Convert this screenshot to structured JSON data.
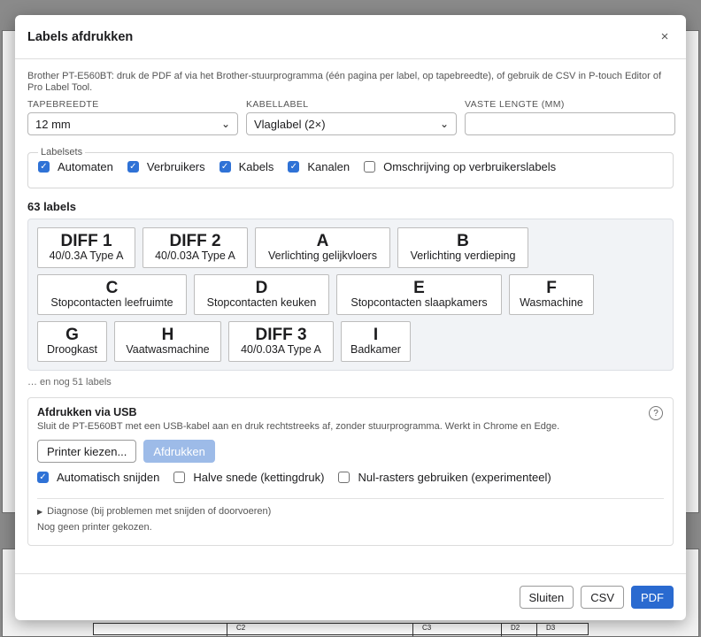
{
  "dialog": {
    "title": "Labels afdrukken",
    "close_glyph": "×",
    "intro": "Brother PT-E560BT: druk de PDF af via het Brother-stuurprogramma (één pagina per label, op tapebreedte), of gebruik de CSV in P-touch Editor of Pro Label Tool."
  },
  "fields": {
    "tape_label": "TAPEBREEDTE",
    "tape_value": "12 mm",
    "cable_label": "KABELLABEL",
    "cable_value": "Vlaglabel (2×)",
    "length_label": "VASTE LENGTE (MM)",
    "length_value": ""
  },
  "labelsets": {
    "legend": "Labelsets",
    "items": [
      {
        "label": "Automaten",
        "checked": true
      },
      {
        "label": "Verbruikers",
        "checked": true
      },
      {
        "label": "Kabels",
        "checked": true
      },
      {
        "label": "Kanalen",
        "checked": true
      },
      {
        "label": "Omschrijving op verbruikerslabels",
        "checked": false
      }
    ]
  },
  "count": "63 labels",
  "labels": [
    {
      "big": "DIFF 1",
      "small": "40/0.3A Type A"
    },
    {
      "big": "DIFF 2",
      "small": "40/0.03A Type A"
    },
    {
      "big": "A",
      "small": "Verlichting gelijkvloers"
    },
    {
      "big": "B",
      "small": "Verlichting verdieping"
    },
    {
      "big": "C",
      "small": "Stopcontacten leefruimte"
    },
    {
      "big": "D",
      "small": "Stopcontacten keuken"
    },
    {
      "big": "E",
      "small": "Stopcontacten slaapkamers"
    },
    {
      "big": "F",
      "small": "Wasmachine"
    },
    {
      "big": "G",
      "small": "Droogkast"
    },
    {
      "big": "H",
      "small": "Vaatwasmachine"
    },
    {
      "big": "DIFF 3",
      "small": "40/0.03A Type A"
    },
    {
      "big": "I",
      "small": "Badkamer"
    }
  ],
  "more_text": "… en nog 51 labels",
  "usb": {
    "title": "Afdrukken via USB",
    "desc": "Sluit de PT-E560BT met een USB-kabel aan en druk rechtstreeks af, zonder stuurprogramma. Werkt in Chrome en Edge.",
    "help_glyph": "?",
    "choose_printer": "Printer kiezen...",
    "print": "Afdrukken",
    "options": [
      {
        "label": "Automatisch snijden",
        "checked": true
      },
      {
        "label": "Halve snede (kettingdruk)",
        "checked": false
      },
      {
        "label": "Nul-rasters gebruiken (experimenteel)",
        "checked": false
      }
    ],
    "diagnose": "Diagnose (bij problemen met snijden of doorvoeren)",
    "status": "Nog geen printer gekozen."
  },
  "footer": {
    "close": "Sluiten",
    "csv": "CSV",
    "pdf": "PDF"
  },
  "background_table": [
    "C2",
    "C3",
    "D2",
    "D3"
  ],
  "colors": {
    "accent": "#2a6ad0",
    "disabled": "#9dbbe8"
  }
}
